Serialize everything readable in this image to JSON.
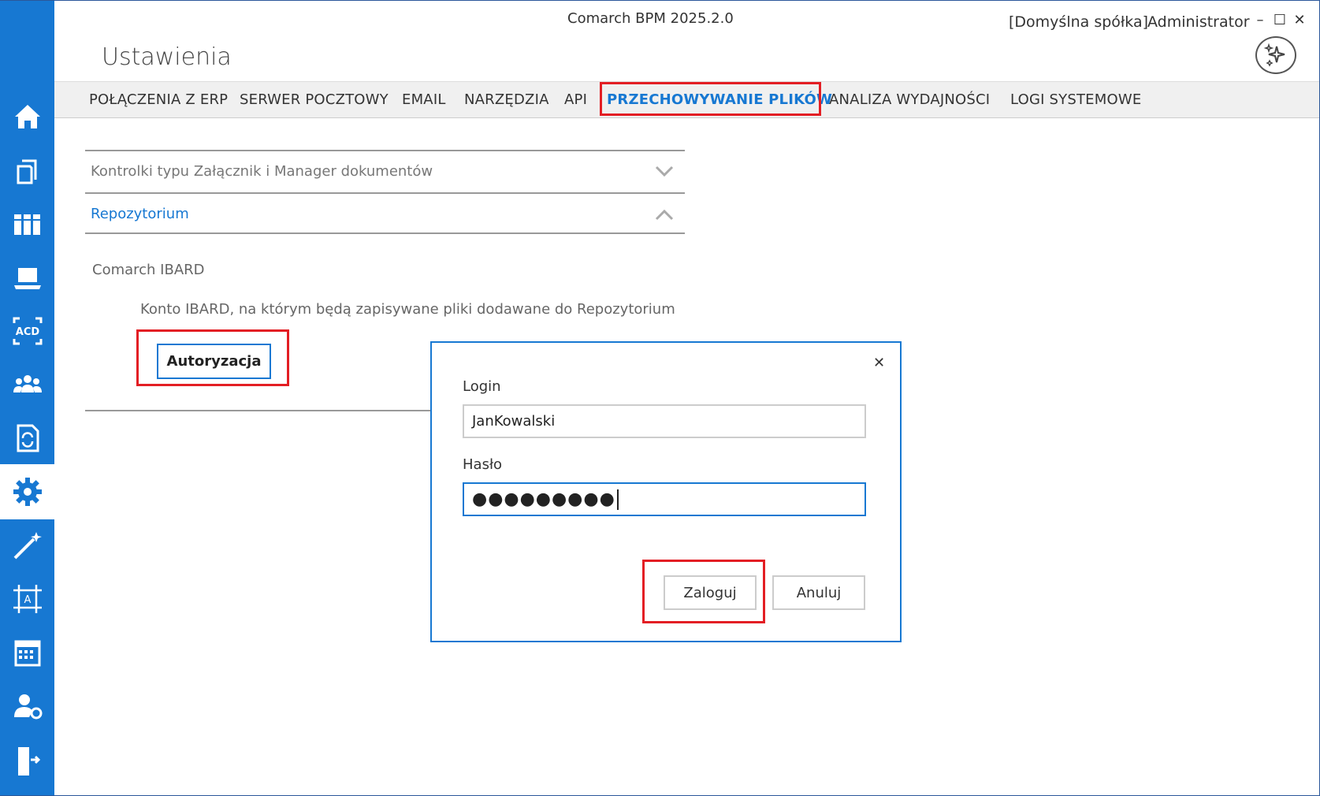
{
  "window": {
    "title": "Comarch BPM 2025.2.0",
    "company": "[Domyślna spółka]",
    "user": "Administrator",
    "minimize": "–",
    "maximize": "☐",
    "close": "✕"
  },
  "page": {
    "title": "Ustawienia"
  },
  "tabs": [
    {
      "label": "POŁĄCZENIA Z ERP"
    },
    {
      "label": "SERWER POCZTOWY"
    },
    {
      "label": "EMAIL"
    },
    {
      "label": "NARZĘDZIA"
    },
    {
      "label": "API"
    },
    {
      "label": "PRZECHOWYWANIE PLIKÓW",
      "active": true
    },
    {
      "label": "ANALIZA WYDAJNOŚCI"
    },
    {
      "label": "LOGI SYSTEMOWE"
    }
  ],
  "sidebar": {
    "items": [
      {
        "icon": "home-icon"
      },
      {
        "icon": "documents-icon"
      },
      {
        "icon": "library-icon"
      },
      {
        "icon": "laptop-icon"
      },
      {
        "icon": "ocr-icon",
        "text": "ACD"
      },
      {
        "icon": "users-icon"
      },
      {
        "icon": "document-sync-icon"
      },
      {
        "icon": "gear-icon",
        "active": true
      },
      {
        "icon": "wand-icon"
      },
      {
        "icon": "designer-icon",
        "text": "A"
      },
      {
        "icon": "calendar-icon"
      },
      {
        "icon": "user-settings-icon"
      },
      {
        "icon": "exit-icon"
      }
    ],
    "accent": "#1778d2"
  },
  "sections": {
    "attachments": {
      "title": "Kontrolki typu Załącznik i Manager dokumentów",
      "expanded": false
    },
    "repository": {
      "title": "Repozytorium",
      "expanded": true
    }
  },
  "repository": {
    "provider": "Comarch IBARD",
    "description": "Konto IBARD, na którym będą zapisywane pliki dodawane do Repozytorium",
    "auth_button": "Autoryzacja"
  },
  "dialog": {
    "close": "✕",
    "login_label": "Login",
    "login_value": "JanKowalski",
    "password_label": "Hasło",
    "password_value": "●●●●●●●●●",
    "login_button": "Zaloguj",
    "cancel_button": "Anuluj"
  },
  "highlight_color": "#e31e24"
}
